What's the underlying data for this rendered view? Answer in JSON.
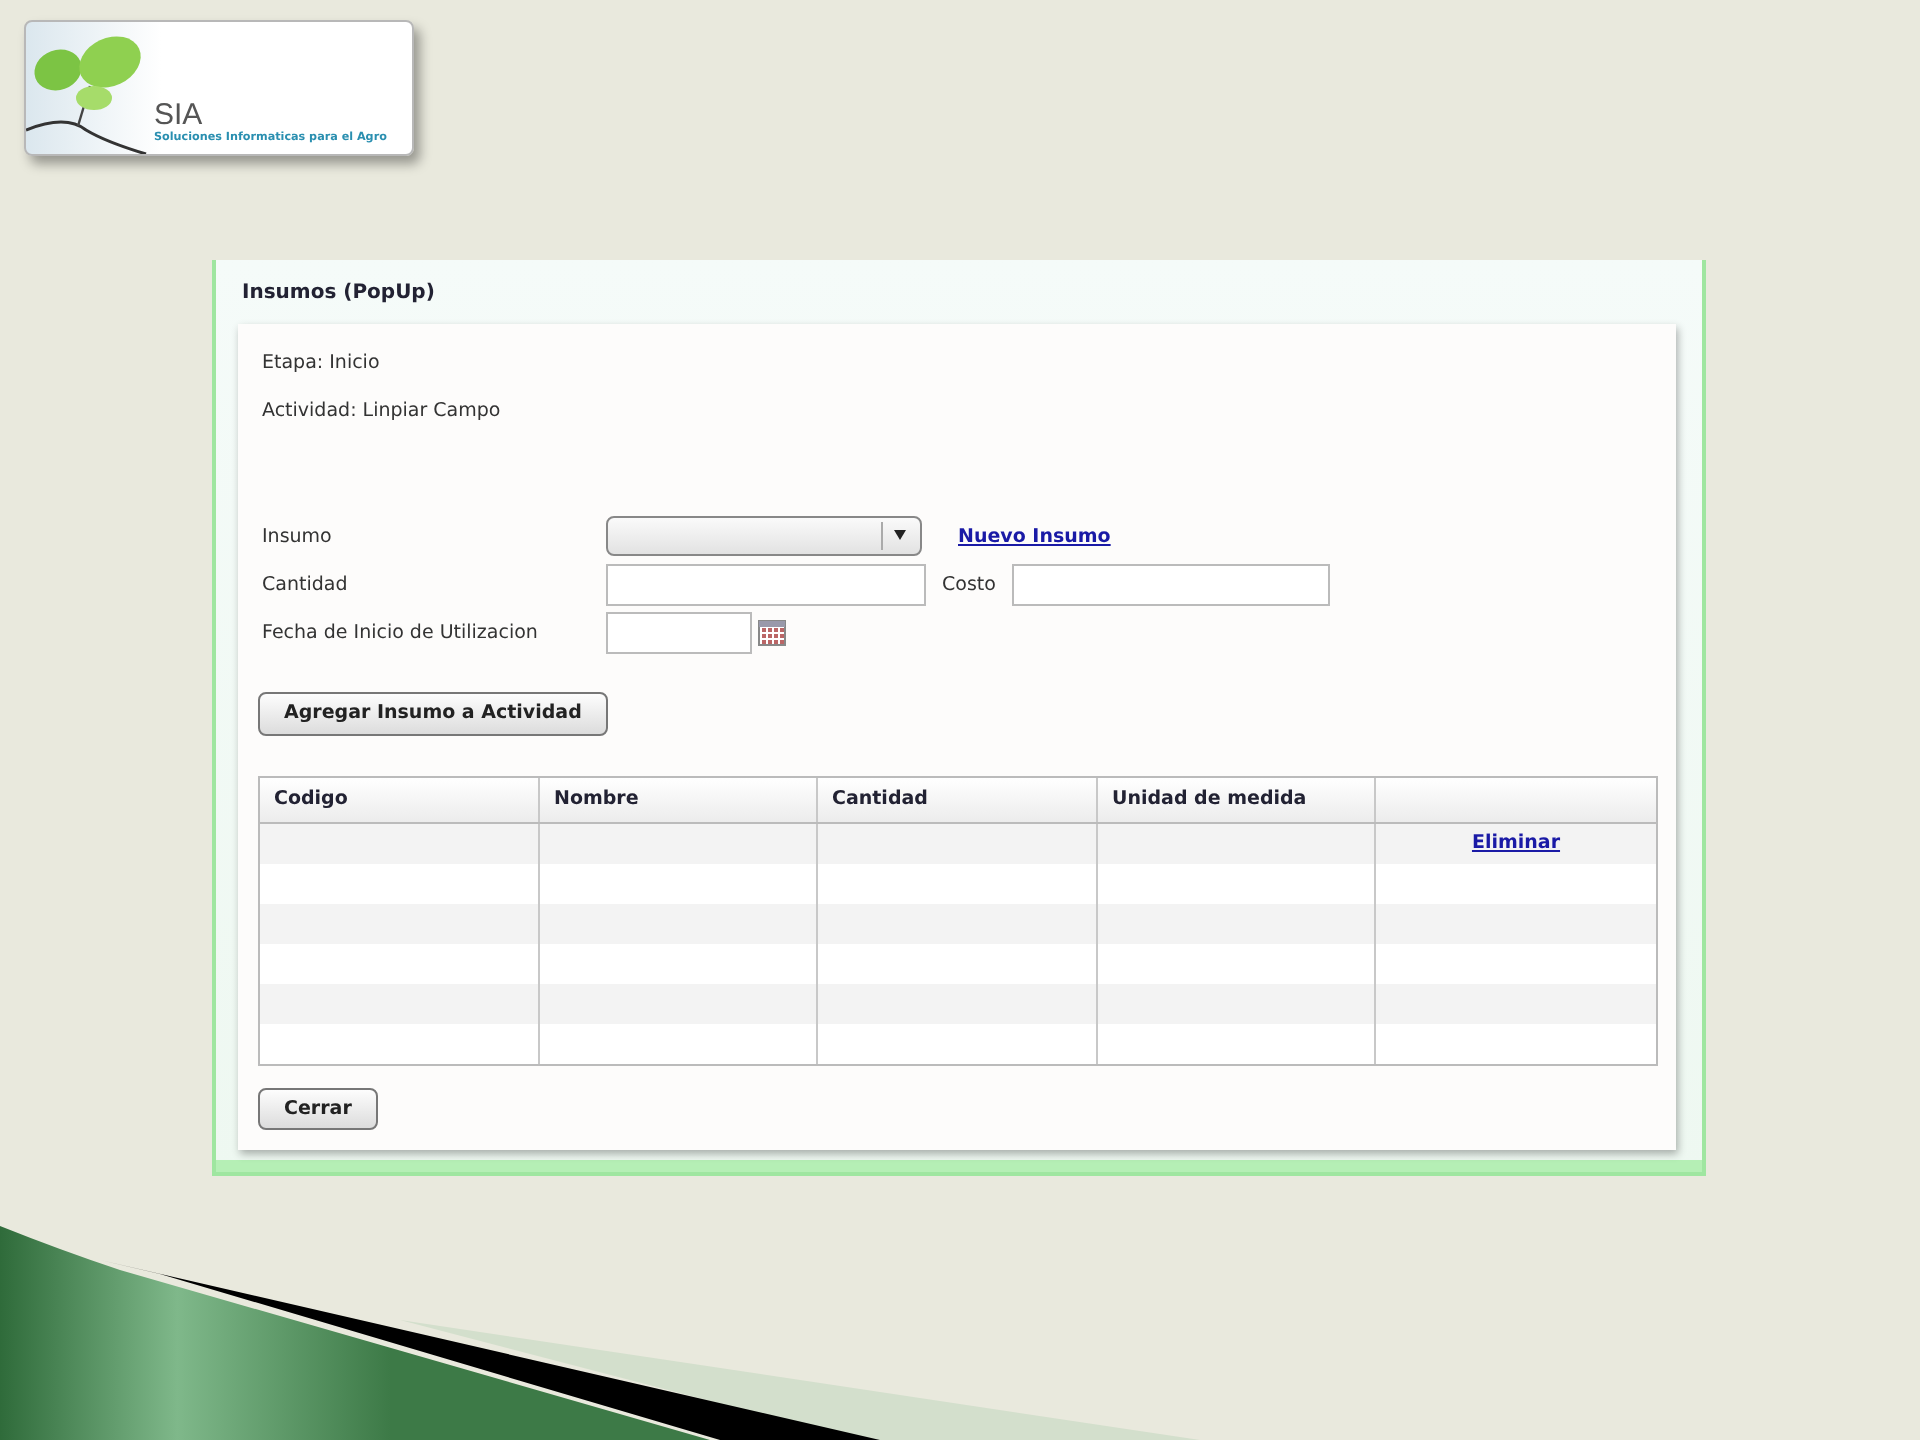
{
  "logo": {
    "name": "SIA",
    "tagline": "Soluciones Informaticas para el Agro"
  },
  "popup": {
    "title": "Insumos (PopUp)",
    "info": [
      "Etapa: Inicio",
      "Actividad: Linpiar Campo"
    ],
    "form": {
      "insumo_label": "Insumo",
      "insumo_link": "Nuevo Insumo",
      "cantidad_label": "Cantidad",
      "costo_label": "Costo",
      "fecha_label": "Fecha de Inicio de Utilizacion",
      "add_button": "Agregar Insumo a Actividad"
    },
    "table": {
      "columns": [
        "Codigo",
        "Nombre",
        "Cantidad",
        "Unidad de medida"
      ],
      "rows": [
        {
          "action": "Eliminar"
        }
      ]
    },
    "close_button": "Cerrar"
  }
}
